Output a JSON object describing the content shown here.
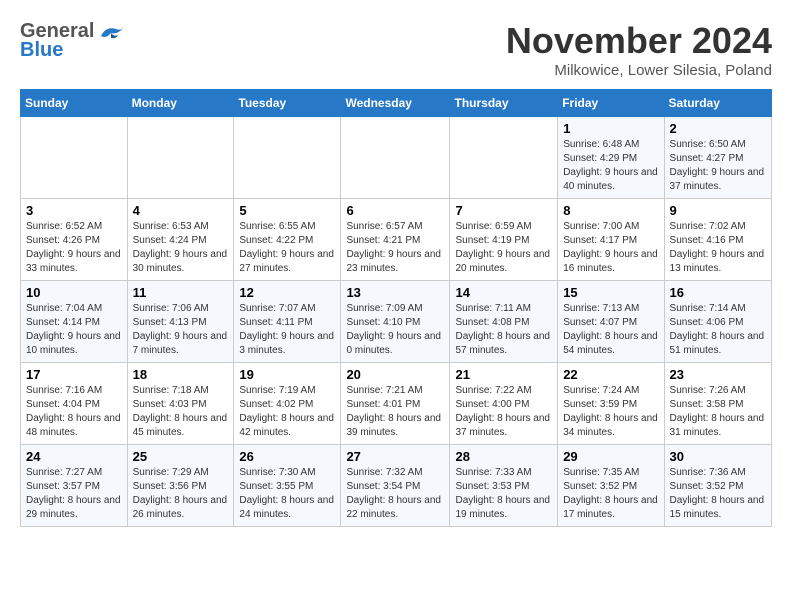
{
  "header": {
    "logo_general": "General",
    "logo_blue": "Blue",
    "month_title": "November 2024",
    "subtitle": "Milkowice, Lower Silesia, Poland"
  },
  "days_of_week": [
    "Sunday",
    "Monday",
    "Tuesday",
    "Wednesday",
    "Thursday",
    "Friday",
    "Saturday"
  ],
  "weeks": [
    [
      {
        "day": "",
        "info": ""
      },
      {
        "day": "",
        "info": ""
      },
      {
        "day": "",
        "info": ""
      },
      {
        "day": "",
        "info": ""
      },
      {
        "day": "",
        "info": ""
      },
      {
        "day": "1",
        "info": "Sunrise: 6:48 AM\nSunset: 4:29 PM\nDaylight: 9 hours and 40 minutes."
      },
      {
        "day": "2",
        "info": "Sunrise: 6:50 AM\nSunset: 4:27 PM\nDaylight: 9 hours and 37 minutes."
      }
    ],
    [
      {
        "day": "3",
        "info": "Sunrise: 6:52 AM\nSunset: 4:26 PM\nDaylight: 9 hours and 33 minutes."
      },
      {
        "day": "4",
        "info": "Sunrise: 6:53 AM\nSunset: 4:24 PM\nDaylight: 9 hours and 30 minutes."
      },
      {
        "day": "5",
        "info": "Sunrise: 6:55 AM\nSunset: 4:22 PM\nDaylight: 9 hours and 27 minutes."
      },
      {
        "day": "6",
        "info": "Sunrise: 6:57 AM\nSunset: 4:21 PM\nDaylight: 9 hours and 23 minutes."
      },
      {
        "day": "7",
        "info": "Sunrise: 6:59 AM\nSunset: 4:19 PM\nDaylight: 9 hours and 20 minutes."
      },
      {
        "day": "8",
        "info": "Sunrise: 7:00 AM\nSunset: 4:17 PM\nDaylight: 9 hours and 16 minutes."
      },
      {
        "day": "9",
        "info": "Sunrise: 7:02 AM\nSunset: 4:16 PM\nDaylight: 9 hours and 13 minutes."
      }
    ],
    [
      {
        "day": "10",
        "info": "Sunrise: 7:04 AM\nSunset: 4:14 PM\nDaylight: 9 hours and 10 minutes."
      },
      {
        "day": "11",
        "info": "Sunrise: 7:06 AM\nSunset: 4:13 PM\nDaylight: 9 hours and 7 minutes."
      },
      {
        "day": "12",
        "info": "Sunrise: 7:07 AM\nSunset: 4:11 PM\nDaylight: 9 hours and 3 minutes."
      },
      {
        "day": "13",
        "info": "Sunrise: 7:09 AM\nSunset: 4:10 PM\nDaylight: 9 hours and 0 minutes."
      },
      {
        "day": "14",
        "info": "Sunrise: 7:11 AM\nSunset: 4:08 PM\nDaylight: 8 hours and 57 minutes."
      },
      {
        "day": "15",
        "info": "Sunrise: 7:13 AM\nSunset: 4:07 PM\nDaylight: 8 hours and 54 minutes."
      },
      {
        "day": "16",
        "info": "Sunrise: 7:14 AM\nSunset: 4:06 PM\nDaylight: 8 hours and 51 minutes."
      }
    ],
    [
      {
        "day": "17",
        "info": "Sunrise: 7:16 AM\nSunset: 4:04 PM\nDaylight: 8 hours and 48 minutes."
      },
      {
        "day": "18",
        "info": "Sunrise: 7:18 AM\nSunset: 4:03 PM\nDaylight: 8 hours and 45 minutes."
      },
      {
        "day": "19",
        "info": "Sunrise: 7:19 AM\nSunset: 4:02 PM\nDaylight: 8 hours and 42 minutes."
      },
      {
        "day": "20",
        "info": "Sunrise: 7:21 AM\nSunset: 4:01 PM\nDaylight: 8 hours and 39 minutes."
      },
      {
        "day": "21",
        "info": "Sunrise: 7:22 AM\nSunset: 4:00 PM\nDaylight: 8 hours and 37 minutes."
      },
      {
        "day": "22",
        "info": "Sunrise: 7:24 AM\nSunset: 3:59 PM\nDaylight: 8 hours and 34 minutes."
      },
      {
        "day": "23",
        "info": "Sunrise: 7:26 AM\nSunset: 3:58 PM\nDaylight: 8 hours and 31 minutes."
      }
    ],
    [
      {
        "day": "24",
        "info": "Sunrise: 7:27 AM\nSunset: 3:57 PM\nDaylight: 8 hours and 29 minutes."
      },
      {
        "day": "25",
        "info": "Sunrise: 7:29 AM\nSunset: 3:56 PM\nDaylight: 8 hours and 26 minutes."
      },
      {
        "day": "26",
        "info": "Sunrise: 7:30 AM\nSunset: 3:55 PM\nDaylight: 8 hours and 24 minutes."
      },
      {
        "day": "27",
        "info": "Sunrise: 7:32 AM\nSunset: 3:54 PM\nDaylight: 8 hours and 22 minutes."
      },
      {
        "day": "28",
        "info": "Sunrise: 7:33 AM\nSunset: 3:53 PM\nDaylight: 8 hours and 19 minutes."
      },
      {
        "day": "29",
        "info": "Sunrise: 7:35 AM\nSunset: 3:52 PM\nDaylight: 8 hours and 17 minutes."
      },
      {
        "day": "30",
        "info": "Sunrise: 7:36 AM\nSunset: 3:52 PM\nDaylight: 8 hours and 15 minutes."
      }
    ]
  ]
}
